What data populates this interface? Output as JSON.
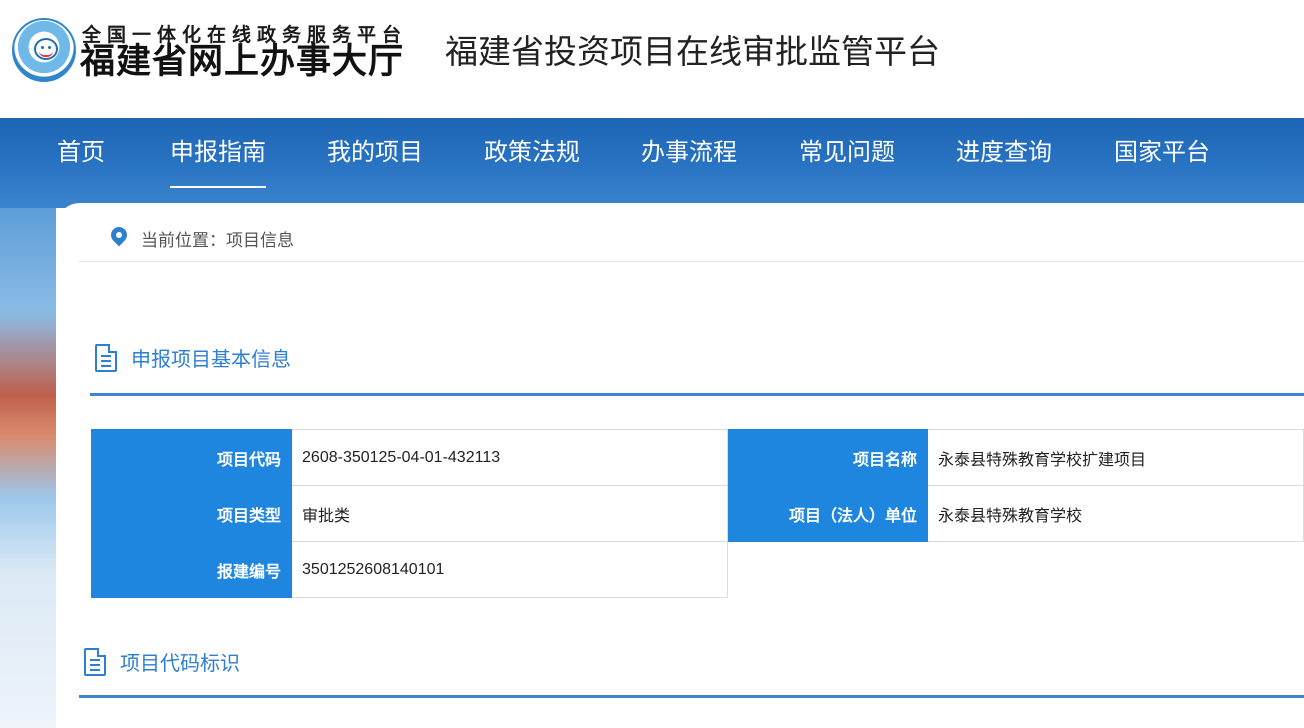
{
  "header": {
    "logo_subtitle": "全国一体化在线政务服务平台",
    "logo_title": "福建省网上办事大厅",
    "site_title": "福建省投资项目在线审批监管平台"
  },
  "nav": {
    "items": [
      {
        "label": "首页"
      },
      {
        "label": "申报指南"
      },
      {
        "label": "我的项目"
      },
      {
        "label": "政策法规"
      },
      {
        "label": "办事流程"
      },
      {
        "label": "常见问题"
      },
      {
        "label": "进度查询"
      },
      {
        "label": "国家平台"
      }
    ],
    "active_index": 1
  },
  "breadcrumb": {
    "text": "当前位置：项目信息"
  },
  "sections": {
    "basic": {
      "title": "申报项目基本信息"
    },
    "code": {
      "title": "项目代码标识"
    }
  },
  "project": {
    "code_label": "项目代码",
    "code_value": "2608-350125-04-01-432113",
    "name_label": "项目名称",
    "name_value": "永泰县特殊教育学校扩建项目",
    "type_label": "项目类型",
    "type_value": "审批类",
    "unit_label": "项目（法人）单位",
    "unit_value": "永泰县特殊教育学校",
    "build_no_label": "报建编号",
    "build_no_value": "3501252608140101"
  },
  "colors": {
    "nav_blue": "#2a74c4",
    "label_blue": "#1f86e0",
    "accent_blue": "#2f7fd0"
  }
}
